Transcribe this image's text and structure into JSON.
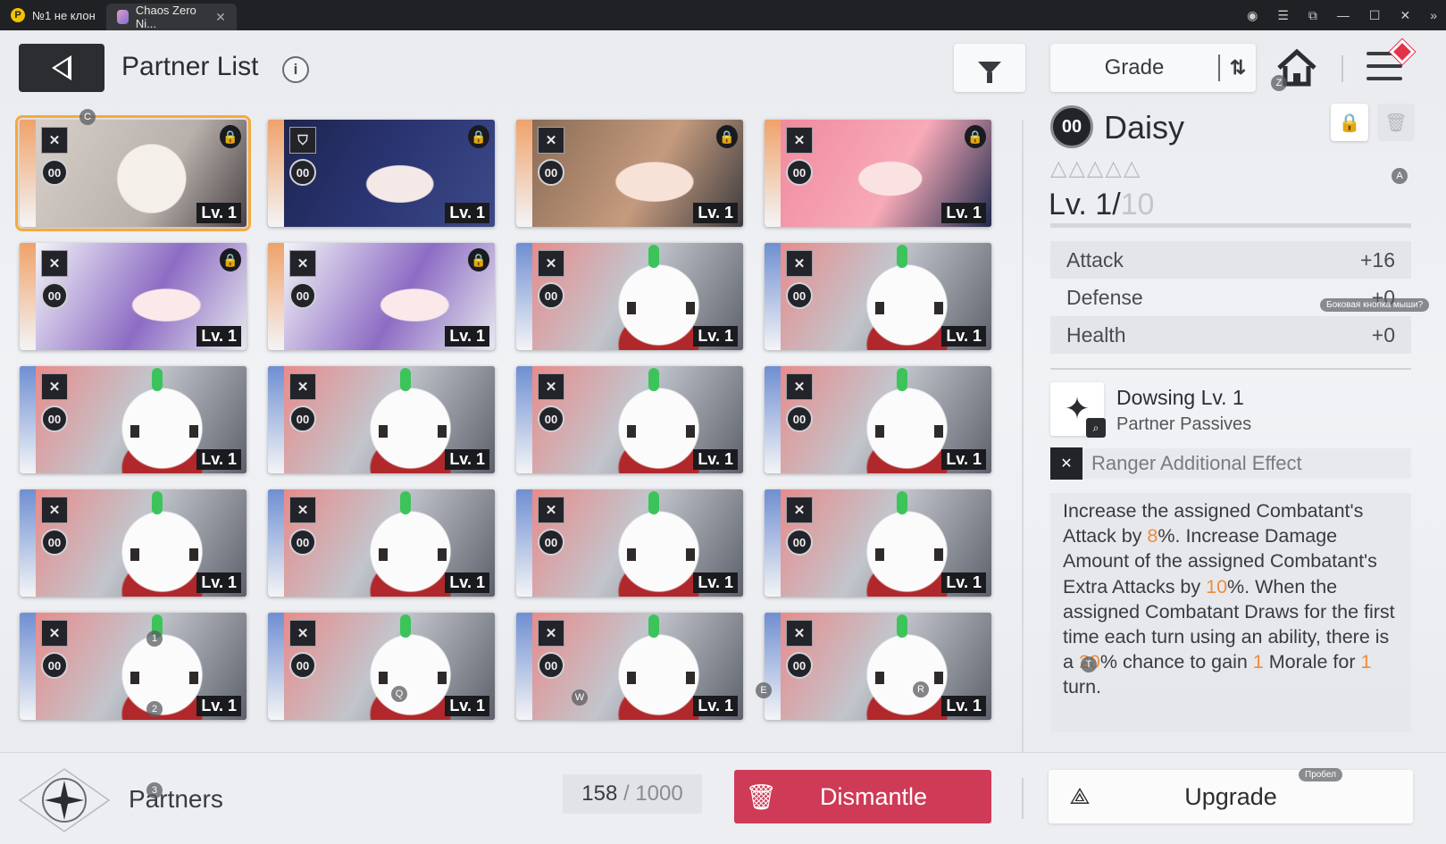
{
  "browser": {
    "tabs": [
      {
        "label": "№1 не клон",
        "icon": "P"
      },
      {
        "label": "Chaos Zero Ni...",
        "close": "✕"
      }
    ],
    "controls": [
      "◉",
      "☰",
      "⧉",
      "—",
      "☐",
      "✕",
      "»"
    ]
  },
  "header": {
    "title": "Partner List",
    "info_glyph": "i",
    "sort_label": "Grade",
    "sort_glyph": "⇅"
  },
  "cards": [
    {
      "portrait": "p-white",
      "strip": "#f0a26a",
      "class": "✕",
      "oo": "00",
      "locked": true,
      "level": "Lv. 1",
      "selected": true
    },
    {
      "portrait": "p-navy",
      "strip": "#f0a26a",
      "class": "⛉",
      "oo": "00",
      "locked": true,
      "level": "Lv. 1"
    },
    {
      "portrait": "p-brown",
      "strip": "#f0a26a",
      "class": "✕",
      "oo": "00",
      "locked": true,
      "level": "Lv. 1"
    },
    {
      "portrait": "p-pink",
      "strip": "#f0a26a",
      "class": "✕",
      "oo": "00",
      "locked": true,
      "level": "Lv. 1"
    },
    {
      "portrait": "p-purple",
      "strip": "#f0a26a",
      "class": "✕",
      "oo": "00",
      "locked": true,
      "level": "Lv. 1"
    },
    {
      "portrait": "p-purple",
      "strip": "#f0a26a",
      "class": "✕",
      "oo": "00",
      "locked": true,
      "level": "Lv. 1"
    },
    {
      "portrait": "p-bunny",
      "strip": "#6f8fd2",
      "class": "✕",
      "oo": "00",
      "locked": false,
      "level": "Lv. 1"
    },
    {
      "portrait": "p-bunny",
      "strip": "#6f8fd2",
      "class": "✕",
      "oo": "00",
      "locked": false,
      "level": "Lv. 1"
    },
    {
      "portrait": "p-bunny",
      "strip": "#6f8fd2",
      "class": "✕",
      "oo": "00",
      "locked": false,
      "level": "Lv. 1"
    },
    {
      "portrait": "p-bunny",
      "strip": "#6f8fd2",
      "class": "✕",
      "oo": "00",
      "locked": false,
      "level": "Lv. 1"
    },
    {
      "portrait": "p-bunny",
      "strip": "#6f8fd2",
      "class": "✕",
      "oo": "00",
      "locked": false,
      "level": "Lv. 1"
    },
    {
      "portrait": "p-bunny",
      "strip": "#6f8fd2",
      "class": "✕",
      "oo": "00",
      "locked": false,
      "level": "Lv. 1"
    },
    {
      "portrait": "p-bunny",
      "strip": "#6f8fd2",
      "class": "✕",
      "oo": "00",
      "locked": false,
      "level": "Lv. 1"
    },
    {
      "portrait": "p-bunny",
      "strip": "#6f8fd2",
      "class": "✕",
      "oo": "00",
      "locked": false,
      "level": "Lv. 1"
    },
    {
      "portrait": "p-bunny",
      "strip": "#6f8fd2",
      "class": "✕",
      "oo": "00",
      "locked": false,
      "level": "Lv. 1"
    },
    {
      "portrait": "p-bunny",
      "strip": "#6f8fd2",
      "class": "✕",
      "oo": "00",
      "locked": false,
      "level": "Lv. 1"
    },
    {
      "portrait": "p-bunny",
      "strip": "#6f8fd2",
      "class": "✕",
      "oo": "00",
      "locked": false,
      "level": "Lv. 1"
    },
    {
      "portrait": "p-bunny",
      "strip": "#6f8fd2",
      "class": "✕",
      "oo": "00",
      "locked": false,
      "level": "Lv. 1"
    },
    {
      "portrait": "p-bunny",
      "strip": "#6f8fd2",
      "class": "✕",
      "oo": "00",
      "locked": false,
      "level": "Lv. 1"
    },
    {
      "portrait": "p-bunny",
      "strip": "#6f8fd2",
      "class": "✕",
      "oo": "00",
      "locked": false,
      "level": "Lv. 1"
    }
  ],
  "detail": {
    "oo": "00",
    "name": "Daisy",
    "lock_glyph": "🔒",
    "trash_glyph": "🗑",
    "stars": "△△△△△",
    "level_prefix": "Lv. 1/",
    "level_max": "10",
    "stats": [
      {
        "name": "Attack",
        "value": "+16"
      },
      {
        "name": "Defense",
        "value": "+0"
      },
      {
        "name": "Health",
        "value": "+0"
      }
    ],
    "skill": {
      "icon": "✦",
      "name": "Dowsing Lv. 1",
      "type": "Partner Passives"
    },
    "ranger_icon": "✕",
    "ranger_label": "Ranger Additional Effect",
    "effect": {
      "s1": "Increase the assigned Combatant's Attack by ",
      "v1": "8",
      "s2": "%. Increase Damage Amount of the assigned Combatant's Extra Attacks by ",
      "v2": "10",
      "s3": "%. When the assigned Combatant Draws for the first time each turn using an ability, there is a ",
      "v3": "20",
      "s4": "% chance to gain ",
      "v4": "1",
      "s5": " Morale for ",
      "v5": "1",
      "s6": " turn."
    }
  },
  "footer": {
    "label": "Partners",
    "count": "158",
    "sep": "/",
    "total": "1000",
    "dismantle_label": "Dismantle",
    "dismantle_glyph": "🗑",
    "upgrade_label": "Upgrade",
    "upgrade_glyph": "⟁"
  },
  "hints": {
    "c": "C",
    "z": "Z",
    "a": "A",
    "one": "1",
    "two": "2",
    "q": "Q",
    "w": "W",
    "e": "E",
    "r": "R",
    "three": "3",
    "t": "T",
    "side_button": "Боковая кнопка мыши?",
    "space": "Пробел"
  },
  "colors": {
    "accent": "#f7a93c",
    "dismantle": "#cf3a57",
    "highlight": "#f08c3a"
  }
}
